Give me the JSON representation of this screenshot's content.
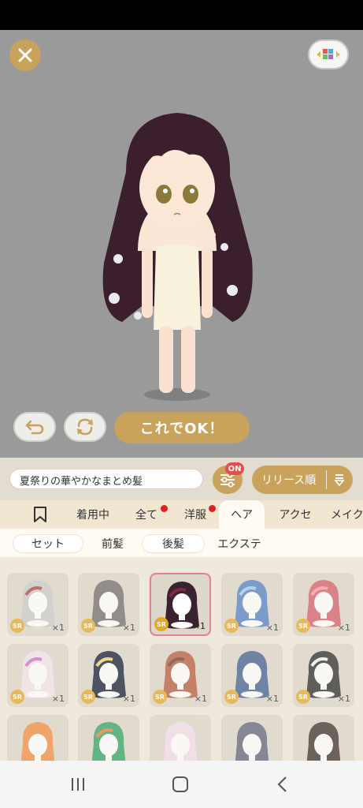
{
  "header": {
    "close_icon": "close-icon",
    "background_toggle_icon": "color-palette-icon"
  },
  "controls": {
    "ok_label": "これでOK！",
    "undo_icon": "undo-icon",
    "rotate_icon": "rotate-icon"
  },
  "search": {
    "value": "夏祭りの華やかなまとめ髪"
  },
  "filter": {
    "badge": "ON",
    "icon": "sliders-icon"
  },
  "sort": {
    "label": "リリース順",
    "icon": "sort-icon"
  },
  "tabs": [
    {
      "label": "",
      "icon": "bookmark-icon"
    },
    {
      "label": "着用中"
    },
    {
      "label": "全て",
      "dot": true
    },
    {
      "label": "洋服",
      "dot": true
    },
    {
      "label": "ヘア",
      "active": true
    },
    {
      "label": "アクセ"
    },
    {
      "label": "メイク"
    }
  ],
  "subtabs": [
    {
      "label": "セット"
    },
    {
      "label": "前髪"
    },
    {
      "label": "後髪"
    },
    {
      "label": "エクステ"
    }
  ],
  "items": [
    {
      "rarity": "SR",
      "count": "×1",
      "hair": "#c9c9c9",
      "accent": "#a8433a"
    },
    {
      "rarity": "SR",
      "count": "×1",
      "hair": "#6f6a6a",
      "accent": "#6f6a6a"
    },
    {
      "rarity": "SR",
      "count": "×1",
      "hair": "#3a2330",
      "accent": "#7d2a3d",
      "selected": true
    },
    {
      "rarity": "SR",
      "count": "×1",
      "hair": "#4f7fc0",
      "accent": "#9fc8f2"
    },
    {
      "rarity": "SR",
      "count": "×1",
      "hair": "#d45b69",
      "accent": "#f39aa0"
    },
    {
      "rarity": "SR",
      "count": "×1",
      "hair": "#f0e4ec",
      "accent": "#d36cc8"
    },
    {
      "rarity": "SR",
      "count": "×1",
      "hair": "#101a35",
      "accent": "#f3d36b"
    },
    {
      "rarity": "SR",
      "count": "×1",
      "hair": "#b65a3b",
      "accent": "#6b3b30"
    },
    {
      "rarity": "SR",
      "count": "×1",
      "hair": "#3f5d8f",
      "accent": "#3f5d8f"
    },
    {
      "rarity": "SR",
      "count": "×1",
      "hair": "#2a2a2a",
      "accent": "#f4f4f4"
    },
    {
      "rarity": "",
      "count": "",
      "hair": "#ef8b3d",
      "accent": "#ef8b3d"
    },
    {
      "rarity": "",
      "count": "",
      "hair": "#2fa264",
      "accent": "#e97a40"
    },
    {
      "rarity": "",
      "count": "",
      "hair": "#f3dcec",
      "accent": "#f3dcec"
    },
    {
      "rarity": "",
      "count": "",
      "hair": "#5f6278",
      "accent": "#5f6278"
    },
    {
      "rarity": "",
      "count": "",
      "hair": "#3a2f2a",
      "accent": "#3a2f2a"
    }
  ],
  "navbar": {
    "recent_icon": "recent-apps-icon",
    "home_icon": "home-icon",
    "back_icon": "back-icon"
  },
  "colors": {
    "accent_gold": "#c9a35c",
    "stage_bg": "#9a9a9a",
    "selected_border": "#e97d92",
    "sr_badge": "#e3a92a",
    "notification_dot": "#e01f1f"
  }
}
